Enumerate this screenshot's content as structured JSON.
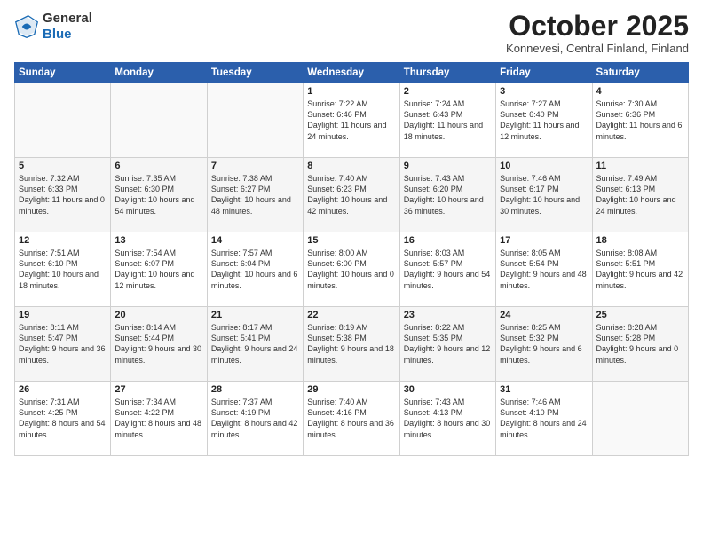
{
  "logo": {
    "general": "General",
    "blue": "Blue"
  },
  "header": {
    "month": "October 2025",
    "location": "Konnevesi, Central Finland, Finland"
  },
  "days_of_week": [
    "Sunday",
    "Monday",
    "Tuesday",
    "Wednesday",
    "Thursday",
    "Friday",
    "Saturday"
  ],
  "weeks": [
    [
      {
        "day": "",
        "info": ""
      },
      {
        "day": "",
        "info": ""
      },
      {
        "day": "",
        "info": ""
      },
      {
        "day": "1",
        "info": "Sunrise: 7:22 AM\nSunset: 6:46 PM\nDaylight: 11 hours\nand 24 minutes."
      },
      {
        "day": "2",
        "info": "Sunrise: 7:24 AM\nSunset: 6:43 PM\nDaylight: 11 hours\nand 18 minutes."
      },
      {
        "day": "3",
        "info": "Sunrise: 7:27 AM\nSunset: 6:40 PM\nDaylight: 11 hours\nand 12 minutes."
      },
      {
        "day": "4",
        "info": "Sunrise: 7:30 AM\nSunset: 6:36 PM\nDaylight: 11 hours\nand 6 minutes."
      }
    ],
    [
      {
        "day": "5",
        "info": "Sunrise: 7:32 AM\nSunset: 6:33 PM\nDaylight: 11 hours\nand 0 minutes."
      },
      {
        "day": "6",
        "info": "Sunrise: 7:35 AM\nSunset: 6:30 PM\nDaylight: 10 hours\nand 54 minutes."
      },
      {
        "day": "7",
        "info": "Sunrise: 7:38 AM\nSunset: 6:27 PM\nDaylight: 10 hours\nand 48 minutes."
      },
      {
        "day": "8",
        "info": "Sunrise: 7:40 AM\nSunset: 6:23 PM\nDaylight: 10 hours\nand 42 minutes."
      },
      {
        "day": "9",
        "info": "Sunrise: 7:43 AM\nSunset: 6:20 PM\nDaylight: 10 hours\nand 36 minutes."
      },
      {
        "day": "10",
        "info": "Sunrise: 7:46 AM\nSunset: 6:17 PM\nDaylight: 10 hours\nand 30 minutes."
      },
      {
        "day": "11",
        "info": "Sunrise: 7:49 AM\nSunset: 6:13 PM\nDaylight: 10 hours\nand 24 minutes."
      }
    ],
    [
      {
        "day": "12",
        "info": "Sunrise: 7:51 AM\nSunset: 6:10 PM\nDaylight: 10 hours\nand 18 minutes."
      },
      {
        "day": "13",
        "info": "Sunrise: 7:54 AM\nSunset: 6:07 PM\nDaylight: 10 hours\nand 12 minutes."
      },
      {
        "day": "14",
        "info": "Sunrise: 7:57 AM\nSunset: 6:04 PM\nDaylight: 10 hours\nand 6 minutes."
      },
      {
        "day": "15",
        "info": "Sunrise: 8:00 AM\nSunset: 6:00 PM\nDaylight: 10 hours\nand 0 minutes."
      },
      {
        "day": "16",
        "info": "Sunrise: 8:03 AM\nSunset: 5:57 PM\nDaylight: 9 hours\nand 54 minutes."
      },
      {
        "day": "17",
        "info": "Sunrise: 8:05 AM\nSunset: 5:54 PM\nDaylight: 9 hours\nand 48 minutes."
      },
      {
        "day": "18",
        "info": "Sunrise: 8:08 AM\nSunset: 5:51 PM\nDaylight: 9 hours\nand 42 minutes."
      }
    ],
    [
      {
        "day": "19",
        "info": "Sunrise: 8:11 AM\nSunset: 5:47 PM\nDaylight: 9 hours\nand 36 minutes."
      },
      {
        "day": "20",
        "info": "Sunrise: 8:14 AM\nSunset: 5:44 PM\nDaylight: 9 hours\nand 30 minutes."
      },
      {
        "day": "21",
        "info": "Sunrise: 8:17 AM\nSunset: 5:41 PM\nDaylight: 9 hours\nand 24 minutes."
      },
      {
        "day": "22",
        "info": "Sunrise: 8:19 AM\nSunset: 5:38 PM\nDaylight: 9 hours\nand 18 minutes."
      },
      {
        "day": "23",
        "info": "Sunrise: 8:22 AM\nSunset: 5:35 PM\nDaylight: 9 hours\nand 12 minutes."
      },
      {
        "day": "24",
        "info": "Sunrise: 8:25 AM\nSunset: 5:32 PM\nDaylight: 9 hours\nand 6 minutes."
      },
      {
        "day": "25",
        "info": "Sunrise: 8:28 AM\nSunset: 5:28 PM\nDaylight: 9 hours\nand 0 minutes."
      }
    ],
    [
      {
        "day": "26",
        "info": "Sunrise: 7:31 AM\nSunset: 4:25 PM\nDaylight: 8 hours\nand 54 minutes."
      },
      {
        "day": "27",
        "info": "Sunrise: 7:34 AM\nSunset: 4:22 PM\nDaylight: 8 hours\nand 48 minutes."
      },
      {
        "day": "28",
        "info": "Sunrise: 7:37 AM\nSunset: 4:19 PM\nDaylight: 8 hours\nand 42 minutes."
      },
      {
        "day": "29",
        "info": "Sunrise: 7:40 AM\nSunset: 4:16 PM\nDaylight: 8 hours\nand 36 minutes."
      },
      {
        "day": "30",
        "info": "Sunrise: 7:43 AM\nSunset: 4:13 PM\nDaylight: 8 hours\nand 30 minutes."
      },
      {
        "day": "31",
        "info": "Sunrise: 7:46 AM\nSunset: 4:10 PM\nDaylight: 8 hours\nand 24 minutes."
      },
      {
        "day": "",
        "info": ""
      }
    ]
  ]
}
